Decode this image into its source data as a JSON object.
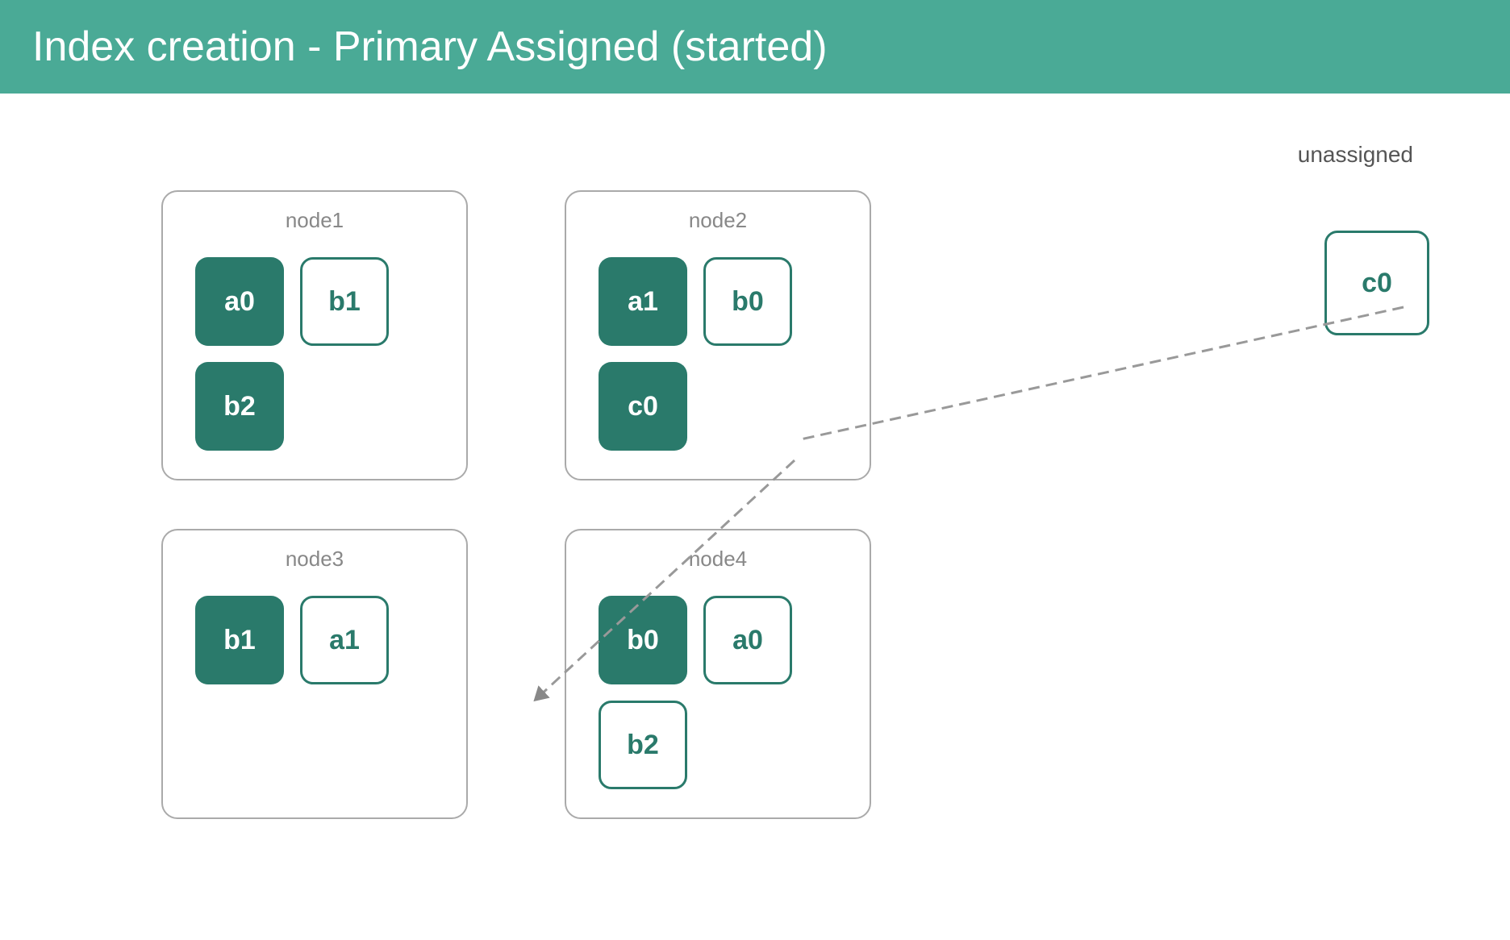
{
  "header": {
    "title": "Index creation - Primary Assigned (started)"
  },
  "unassigned": {
    "label": "unassigned",
    "shard": "c0"
  },
  "nodes": [
    {
      "id": "node1",
      "label": "node1",
      "shards": [
        {
          "label": "a0",
          "type": "primary"
        },
        {
          "label": "b1",
          "type": "replica"
        },
        {
          "label": "b2",
          "type": "primary"
        }
      ]
    },
    {
      "id": "node2",
      "label": "node2",
      "shards": [
        {
          "label": "a1",
          "type": "primary"
        },
        {
          "label": "b0",
          "type": "replica"
        },
        {
          "label": "c0",
          "type": "primary"
        }
      ]
    },
    {
      "id": "node3",
      "label": "node3",
      "shards": [
        {
          "label": "b1",
          "type": "primary"
        },
        {
          "label": "a1",
          "type": "replica"
        }
      ]
    },
    {
      "id": "node4",
      "label": "node4",
      "shards": [
        {
          "label": "b0",
          "type": "primary"
        },
        {
          "label": "a0",
          "type": "replica"
        },
        {
          "label": "b2",
          "type": "replica"
        }
      ]
    }
  ]
}
